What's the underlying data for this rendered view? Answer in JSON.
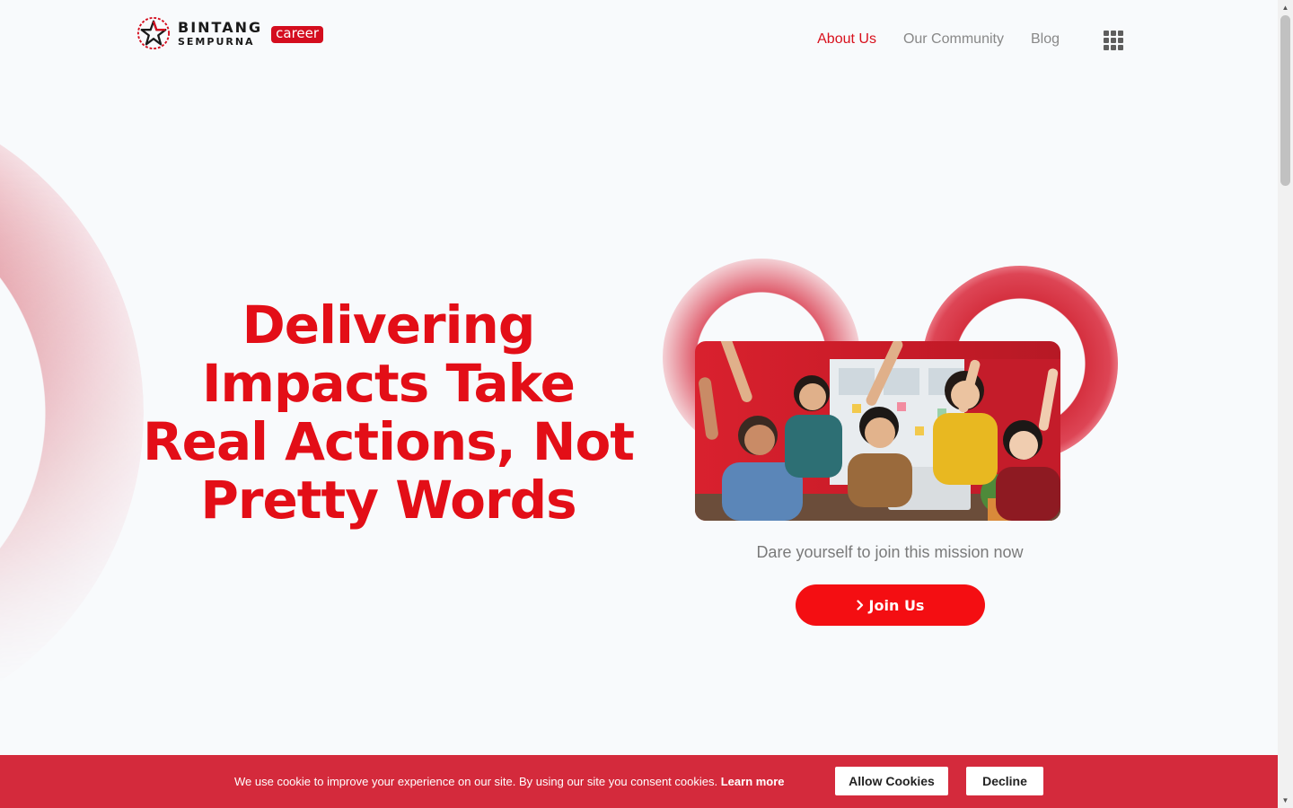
{
  "brand": {
    "line1": "BINTANG",
    "line2": "SEMPURNA",
    "badge": "career"
  },
  "nav": {
    "items": [
      {
        "label": "About Us",
        "active": true
      },
      {
        "label": "Our Community",
        "active": false
      },
      {
        "label": "Blog",
        "active": false
      }
    ],
    "apps_icon": "grid-icon"
  },
  "hero": {
    "title": "Delivering Impacts Take Real Actions, Not Pretty Words",
    "subtitle": "Dare yourself to join this mission now",
    "cta_icon": "chevron-right-icon",
    "cta_label": "Join Us"
  },
  "cookie": {
    "message": "We use cookie to improve your experience on our site. By using our site you consent cookies.",
    "learn_more": "Learn more",
    "allow": "Allow Cookies",
    "decline": "Decline"
  },
  "colors": {
    "brand_red": "#e30e17",
    "cookie_bar": "#d42a3c",
    "button_red": "#f40e12"
  }
}
